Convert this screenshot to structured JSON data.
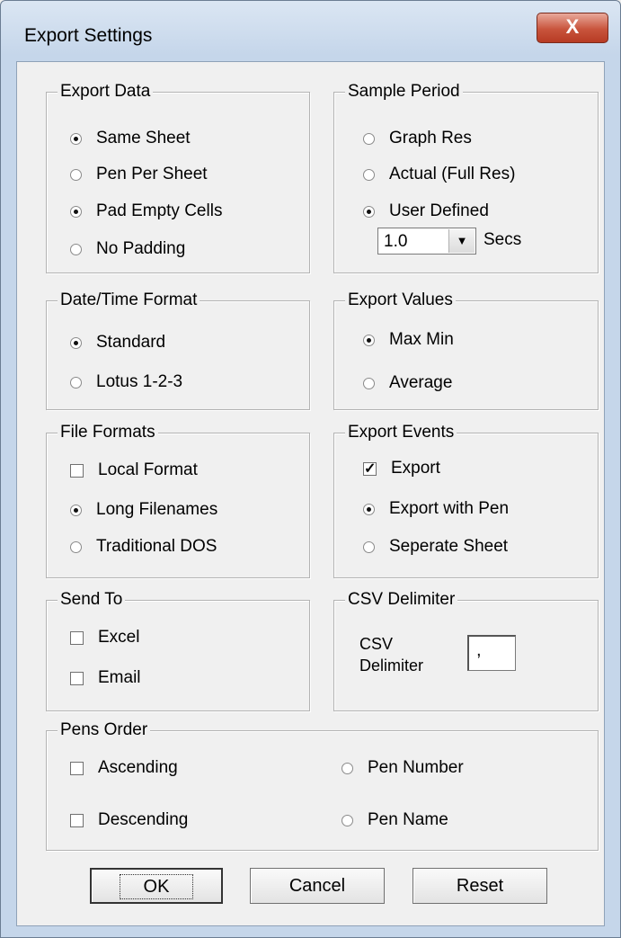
{
  "window": {
    "title": "Export Settings",
    "close_glyph": "X"
  },
  "export_data": {
    "legend": "Export Data",
    "options": [
      {
        "label": "Same Sheet",
        "type": "radio",
        "checked": true
      },
      {
        "label": "Pen Per Sheet",
        "type": "radio",
        "checked": false
      },
      {
        "label": "Pad Empty Cells",
        "type": "radio",
        "checked": true
      },
      {
        "label": "No Padding",
        "type": "radio",
        "checked": false
      }
    ]
  },
  "sample_period": {
    "legend": "Sample Period",
    "options": [
      {
        "label": "Graph Res",
        "type": "radio",
        "checked": false
      },
      {
        "label": "Actual (Full Res)",
        "type": "radio",
        "checked": false
      },
      {
        "label": "User Defined",
        "type": "radio",
        "checked": true
      }
    ],
    "period_value": "1.0",
    "period_unit": "Secs"
  },
  "date_time_format": {
    "legend": "Date/Time Format",
    "options": [
      {
        "label": "Standard",
        "type": "radio",
        "checked": true
      },
      {
        "label": "Lotus 1-2-3",
        "type": "radio",
        "checked": false
      }
    ]
  },
  "export_values": {
    "legend": "Export Values",
    "options": [
      {
        "label": "Max Min",
        "type": "radio",
        "checked": true
      },
      {
        "label": "Average",
        "type": "radio",
        "checked": false
      }
    ]
  },
  "file_formats": {
    "legend": "File Formats",
    "options": [
      {
        "label": "Local Format",
        "type": "checkbox",
        "checked": false
      },
      {
        "label": "Long Filenames",
        "type": "radio",
        "checked": true
      },
      {
        "label": "Traditional DOS",
        "type": "radio",
        "checked": false
      }
    ]
  },
  "export_events": {
    "legend": "Export Events",
    "options": [
      {
        "label": "Export",
        "type": "checkbox",
        "checked": true
      },
      {
        "label": "Export with Pen",
        "type": "radio",
        "checked": true
      },
      {
        "label": "Seperate Sheet",
        "type": "radio",
        "checked": false
      }
    ]
  },
  "send_to": {
    "legend": "Send To",
    "options": [
      {
        "label": "Excel",
        "type": "checkbox",
        "checked": false
      },
      {
        "label": "Email",
        "type": "checkbox",
        "checked": false
      }
    ]
  },
  "csv_delimiter": {
    "legend": "CSV Delimiter",
    "label_line1": "CSV",
    "label_line2": "Delimiter",
    "value": ","
  },
  "pens_order": {
    "legend": "Pens Order",
    "options": [
      {
        "label": "Ascending",
        "type": "checkbox",
        "checked": false
      },
      {
        "label": "Descending",
        "type": "checkbox",
        "checked": false
      },
      {
        "label": "Pen Number",
        "type": "radio",
        "checked": false
      },
      {
        "label": "Pen Name",
        "type": "radio",
        "checked": false
      }
    ]
  },
  "buttons": {
    "ok": "OK",
    "cancel": "Cancel",
    "reset": "Reset"
  },
  "icons": {
    "dropdown": "chevron-down-icon",
    "check": "checkmark-icon"
  }
}
